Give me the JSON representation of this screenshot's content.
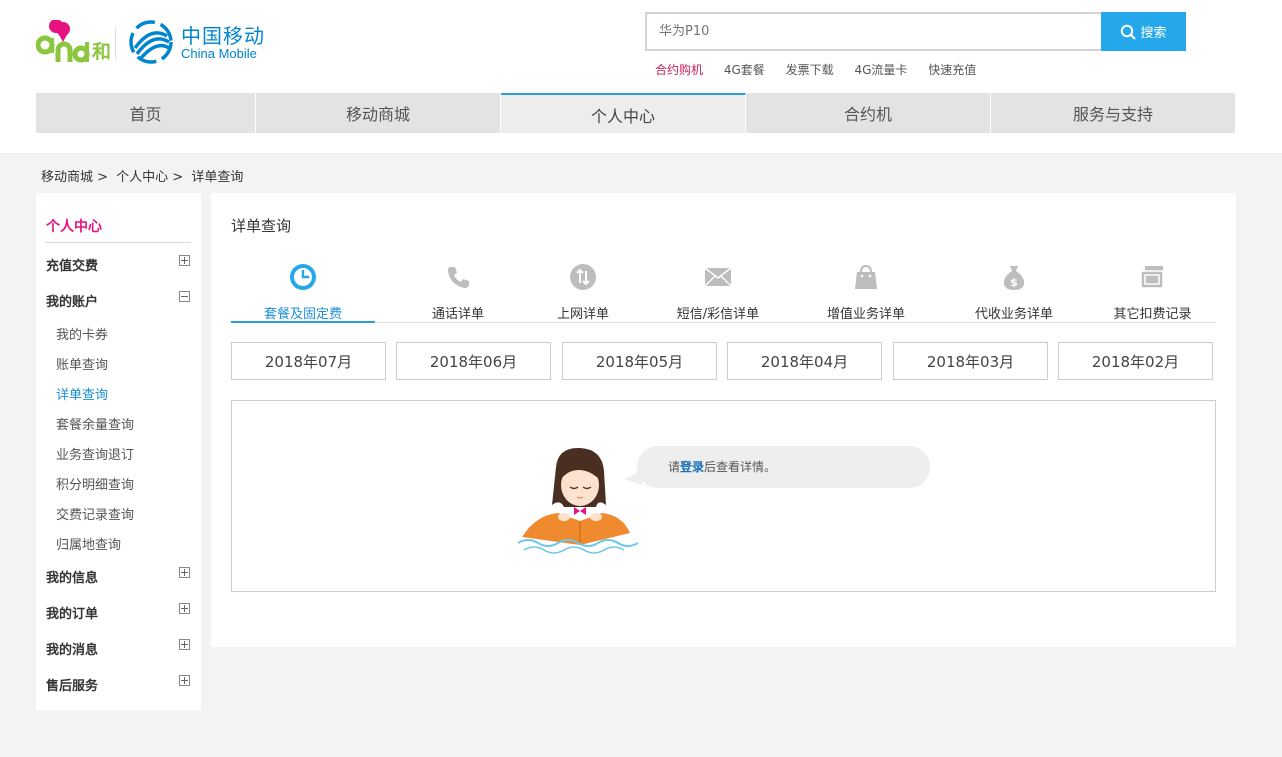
{
  "brand": {
    "and_logo_text": "and",
    "he_logo_text": "和",
    "cm_cn": "中国移动",
    "cm_en": "China Mobile"
  },
  "search": {
    "placeholder": "华为P10",
    "button_label": "搜索"
  },
  "hot_links": [
    {
      "label": "合约购机",
      "highlight": true
    },
    {
      "label": "4G套餐",
      "highlight": false
    },
    {
      "label": "发票下载",
      "highlight": false
    },
    {
      "label": "4G流量卡",
      "highlight": false
    },
    {
      "label": "快速充值",
      "highlight": false
    }
  ],
  "nav": [
    {
      "label": "首页",
      "active": false
    },
    {
      "label": "移动商城",
      "active": false
    },
    {
      "label": "个人中心",
      "active": true
    },
    {
      "label": "合约机",
      "active": false
    },
    {
      "label": "服务与支持",
      "active": false
    }
  ],
  "breadcrumb": [
    "移动商城 >",
    "个人中心 >",
    "详单查询"
  ],
  "sidebar": {
    "title": "个人中心",
    "groups": [
      {
        "label": "充值交费",
        "expanded": false
      },
      {
        "label": "我的账户",
        "expanded": true
      },
      {
        "label": "我的信息",
        "expanded": false
      },
      {
        "label": "我的订单",
        "expanded": false
      },
      {
        "label": "我的消息",
        "expanded": false
      },
      {
        "label": "售后服务",
        "expanded": false
      }
    ],
    "account_items": [
      {
        "label": "我的卡券",
        "active": false
      },
      {
        "label": "账单查询",
        "active": false
      },
      {
        "label": "详单查询",
        "active": true
      },
      {
        "label": "套餐余量查询",
        "active": false
      },
      {
        "label": "业务查询退订",
        "active": false
      },
      {
        "label": "积分明细查询",
        "active": false
      },
      {
        "label": "交费记录查询",
        "active": false
      },
      {
        "label": "归属地查询",
        "active": false
      }
    ]
  },
  "main": {
    "title": "详单查询",
    "tabs": [
      {
        "label": "套餐及固定费",
        "icon": "pie-clock-icon",
        "active": true
      },
      {
        "label": "通话详单",
        "icon": "phone-icon",
        "active": false
      },
      {
        "label": "上网详单",
        "icon": "data-transfer-icon",
        "active": false
      },
      {
        "label": "短信/彩信详单",
        "icon": "envelope-icon",
        "active": false
      },
      {
        "label": "增值业务详单",
        "icon": "shopping-bag-icon",
        "active": false
      },
      {
        "label": "代收业务详单",
        "icon": "money-bag-icon",
        "active": false
      },
      {
        "label": "其它扣费记录",
        "icon": "record-card-icon",
        "active": false
      }
    ],
    "months": [
      "2018年07月",
      "2018年06月",
      "2018年05月",
      "2018年04月",
      "2018年03月",
      "2018年02月"
    ],
    "empty": {
      "prefix": "请",
      "login_link": "登录",
      "suffix": "后查看详情。"
    }
  },
  "colors": {
    "accent": "#24a8eb",
    "nav_active_border": "#2a9fd8",
    "sidebar_title": "#e6127f",
    "hot_link": "#c8205a",
    "and_green": "#8cc63f",
    "and_pink": "#e6127f"
  }
}
